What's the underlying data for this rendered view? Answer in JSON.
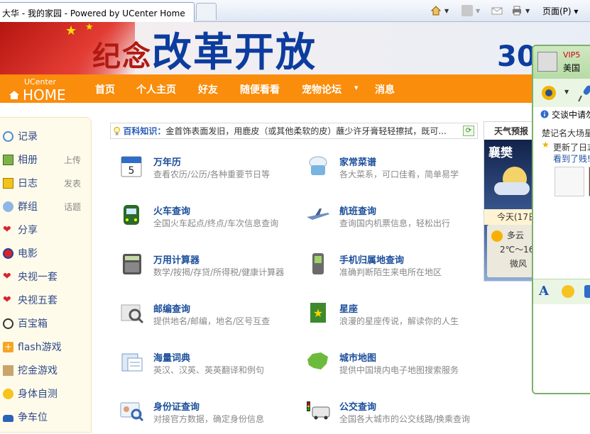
{
  "browser": {
    "tab_title": "大华 - 我的家园 - Powered by UCenter Home",
    "page_menu": "页面(P) ▾"
  },
  "banner": {
    "text_small": "纪念",
    "text_big": "改革开放",
    "text_num": "30"
  },
  "nav": {
    "logo_top": "UCenter",
    "logo_home": "HOME",
    "items": [
      "首页",
      "个人主页",
      "好友",
      "随便看看",
      "宠物论坛",
      "消息"
    ],
    "dropdown": "▾"
  },
  "sidebar": {
    "items": [
      {
        "label": "记录",
        "sub": "",
        "icon": "speech-icon"
      },
      {
        "label": "相册",
        "sub": "上传",
        "icon": "photo-icon"
      },
      {
        "label": "日志",
        "sub": "发表",
        "icon": "journal-icon"
      },
      {
        "label": "群组",
        "sub": "话题",
        "icon": "group-icon"
      },
      {
        "label": "分享",
        "sub": "",
        "icon": "heart-icon"
      },
      {
        "label": "电影",
        "sub": "",
        "icon": "play-icon"
      },
      {
        "label": "央视一套",
        "sub": "",
        "icon": "heart-icon"
      },
      {
        "label": "央视五套",
        "sub": "",
        "icon": "heart-icon"
      },
      {
        "label": "百宝箱",
        "sub": "",
        "icon": "clock-icon"
      },
      {
        "label": "flash游戏",
        "sub": "",
        "icon": "plus-icon"
      },
      {
        "label": "挖金游戏",
        "sub": "",
        "icon": "avatar-icon"
      },
      {
        "label": "身体自测",
        "sub": "",
        "icon": "smile-icon"
      },
      {
        "label": "争车位",
        "sub": "",
        "icon": "car-icon"
      }
    ]
  },
  "baike": {
    "title": "百科知识：",
    "text": "金首饰表面发旧，用鹿皮（或其他柔软的皮）蘸少许牙膏轻轻擦拭，既可...",
    "refresh": "⟳"
  },
  "tools": [
    {
      "name": "万年历",
      "desc": "查看农历/公历/各种重要节日等",
      "icon": "calendar-icon"
    },
    {
      "name": "家常菜谱",
      "desc": "各大菜系，可口佳肴，简单易学",
      "icon": "chef-icon"
    },
    {
      "name": "火车查询",
      "desc": "全国火车起点/终点/车次信息查询",
      "icon": "train-icon"
    },
    {
      "name": "航班查询",
      "desc": "查询国内机票信息，轻松出行",
      "icon": "plane-icon"
    },
    {
      "name": "万用计算器",
      "desc": "数学/按揭/存贷/所得税/健康计算器",
      "icon": "calculator-icon"
    },
    {
      "name": "手机归属地查询",
      "desc": "准确判断陌生来电所在地区",
      "icon": "mobile-phone-icon"
    },
    {
      "name": "邮编查询",
      "desc": "提供地名/邮编，地名/区号互查",
      "icon": "postcode-icon"
    },
    {
      "name": "星座",
      "desc": "浪漫的星座传说，解读你的人生",
      "icon": "star-book-icon"
    },
    {
      "name": "海量词典",
      "desc": "英汉、汉英、英英翻译和例句",
      "icon": "dictionary-icon"
    },
    {
      "name": "城市地图",
      "desc": "提供中国境内电子地图搜索服务",
      "icon": "china-map-icon"
    },
    {
      "name": "身份证查询",
      "desc": "对接官方数据，确定身份信息",
      "icon": "id-card-icon"
    },
    {
      "name": "公交查询",
      "desc": "全国各大城市的公交线路/换乘查询",
      "icon": "bus-icon"
    }
  ],
  "weather": {
    "title": "天气预报",
    "city": "襄樊",
    "today": "今天(17日",
    "condition": "多云",
    "temp": "2℃～16",
    "wind": "微风"
  },
  "qq": {
    "vip": "VIP5",
    "name": "美国",
    "line1": "交谈中请勿",
    "line2": "楚记名大场星",
    "line3": "更新了日志",
    "line4": "看到了贱!"
  }
}
